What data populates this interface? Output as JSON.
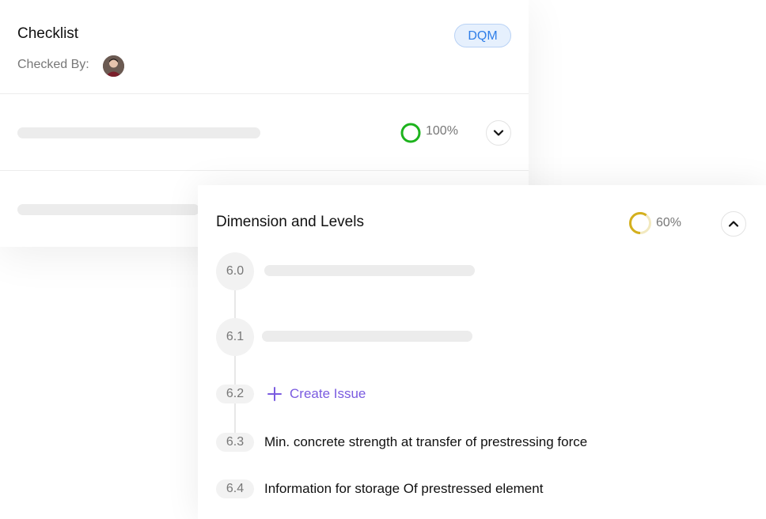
{
  "checklist": {
    "title": "Checklist",
    "badge": "DQM",
    "checked_by_label": "Checked By:",
    "rows": [
      {
        "percent_label": "100%",
        "progress": 1.0,
        "ring_color": "#1db31d",
        "chevron": "chevron-down-icon"
      }
    ]
  },
  "section": {
    "title": "Dimension and Levels",
    "percent_label": "60%",
    "progress": 0.6,
    "ring_color": "#d4b01e",
    "chevron": "chevron-up-icon",
    "items": [
      {
        "num": "6.0",
        "text": ""
      },
      {
        "num": "6.1",
        "text": ""
      },
      {
        "num": "6.2",
        "action": "Create Issue"
      },
      {
        "num": "6.3",
        "text": "Min. concrete strength at transfer of prestressing force"
      },
      {
        "num": "6.4",
        "text": "Information for storage Of prestressed element"
      }
    ]
  },
  "colors": {
    "accent": "#7a5be0",
    "badge_text": "#2f7ee8",
    "badge_bg": "#e6f0fd"
  }
}
